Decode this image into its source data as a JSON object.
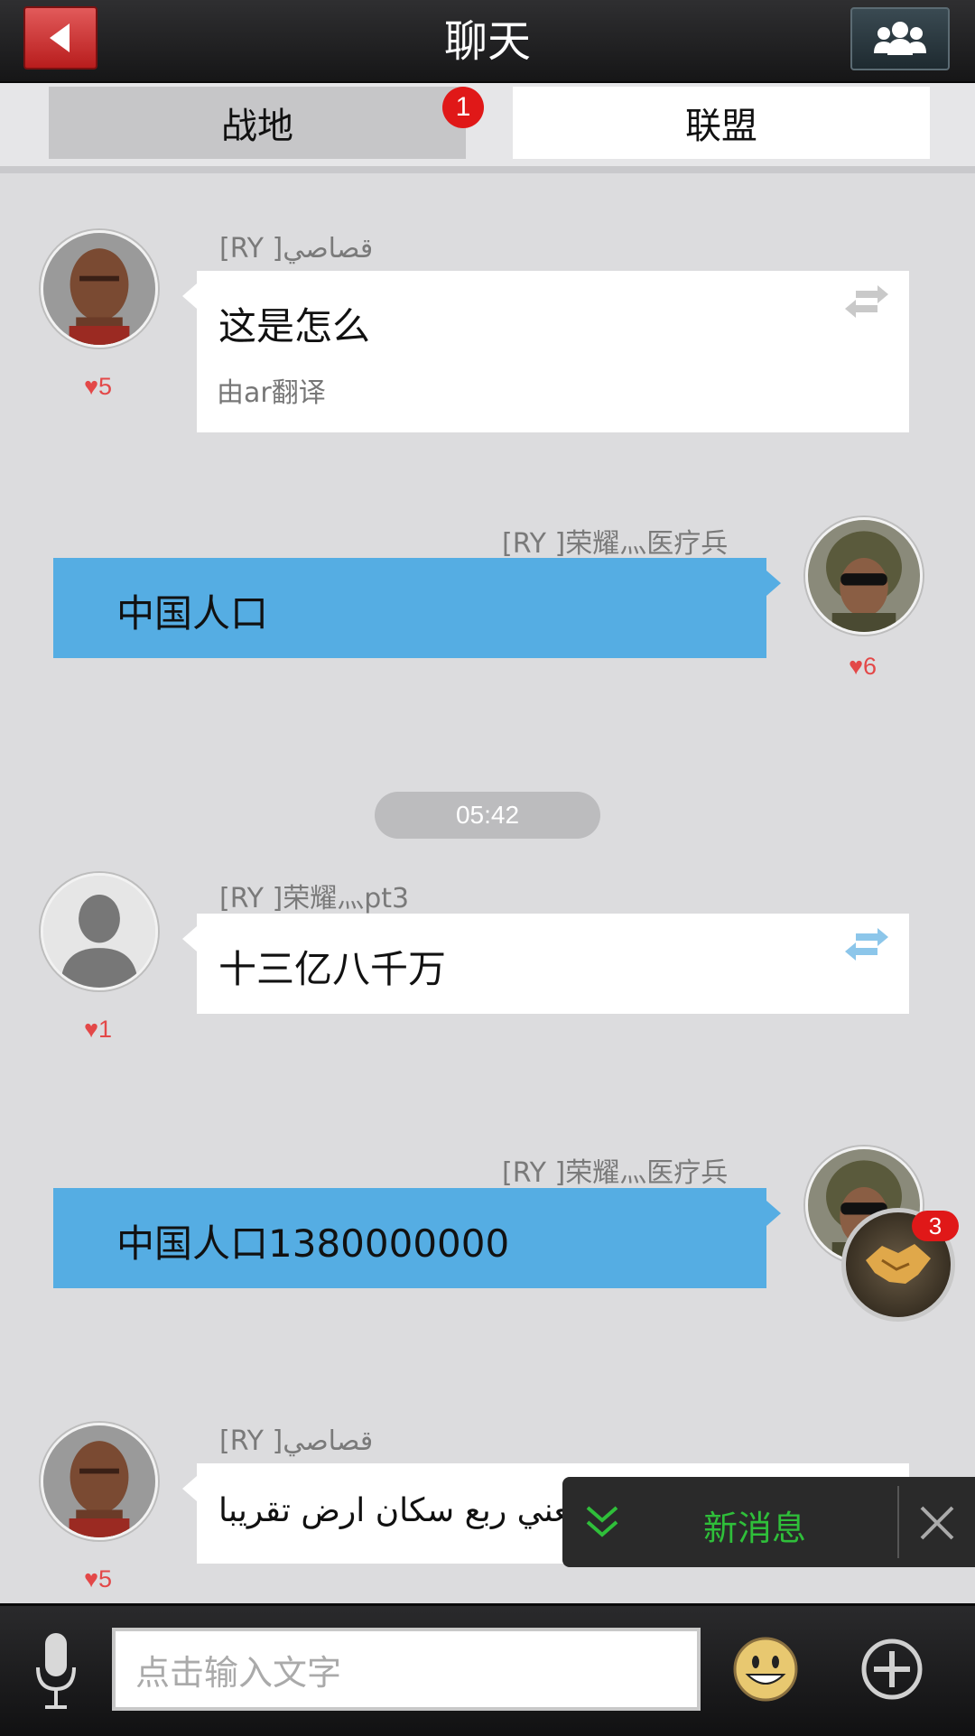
{
  "header": {
    "title": "聊天"
  },
  "tabs": [
    {
      "label": "战地",
      "badge": "1"
    },
    {
      "label": "联盟"
    }
  ],
  "messages": [
    {
      "sender": "[RY ]قصاصي",
      "likes": "5",
      "text": "这是怎么",
      "translation_note": "由ar翻译"
    },
    {
      "sender": "[RY ]荣耀灬医疗兵",
      "likes": "6",
      "text": "中国人口"
    },
    {
      "sender": "[RY ]荣耀灬pt3",
      "likes": "1",
      "text": "十三亿八千万"
    },
    {
      "sender": "[RY ]荣耀灬医疗兵",
      "likes": "",
      "text": "中国人口1380000000"
    },
    {
      "sender": "[RY ]قصاصي",
      "likes": "5",
      "text": "يعني ربع سكان ارض تقريبا"
    }
  ],
  "timestamp": "05:42",
  "alliance_badge": "3",
  "new_message": {
    "label": "新消息"
  },
  "input": {
    "placeholder": "点击输入文字"
  },
  "colors": {
    "accent_blue": "#55ade3",
    "header_red": "#c9302c",
    "new_msg_green": "#2fbf3a",
    "badge_red": "#e01818"
  }
}
